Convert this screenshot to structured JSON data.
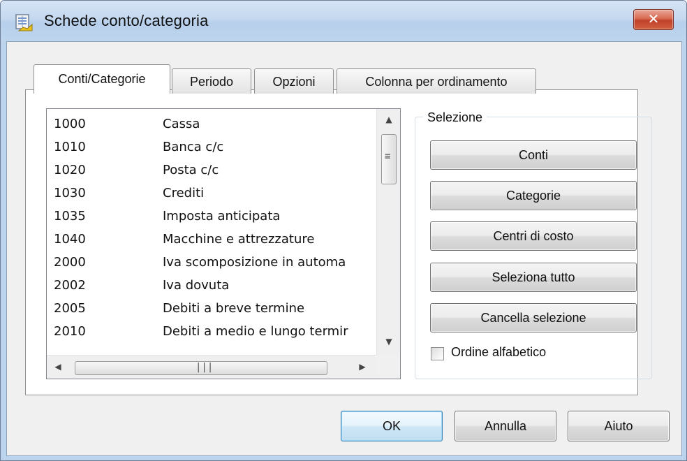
{
  "window": {
    "title": "Schede conto/categoria"
  },
  "tabs": [
    {
      "label": "Conti/Categorie"
    },
    {
      "label": "Periodo"
    },
    {
      "label": "Opzioni"
    },
    {
      "label": "Colonna per ordinamento"
    }
  ],
  "accounts": [
    {
      "code": "1000",
      "name": "Cassa"
    },
    {
      "code": "1010",
      "name": "Banca c/c"
    },
    {
      "code": "1020",
      "name": "Posta c/c"
    },
    {
      "code": "1030",
      "name": "Crediti"
    },
    {
      "code": "1035",
      "name": "Imposta anticipata"
    },
    {
      "code": "1040",
      "name": "Macchine e attrezzature"
    },
    {
      "code": "2000",
      "name": "Iva scomposizione in automa"
    },
    {
      "code": "2002",
      "name": "Iva dovuta"
    },
    {
      "code": "2005",
      "name": "Debiti a breve termine"
    },
    {
      "code": "2010",
      "name": "Debiti a medio e lungo termir"
    }
  ],
  "selection": {
    "group_label": "Selezione",
    "buttons": [
      {
        "label": "Conti"
      },
      {
        "label": "Categorie"
      },
      {
        "label": "Centri di costo"
      },
      {
        "label": "Seleziona tutto"
      },
      {
        "label": "Cancella selezione"
      }
    ],
    "checkbox": {
      "label": "Ordine alfabetico",
      "checked": false
    }
  },
  "footer": {
    "ok": "OK",
    "cancel": "Annulla",
    "help": "Aiuto"
  },
  "colors": {
    "accent": "#3c7fb1",
    "close": "#c0402a"
  }
}
